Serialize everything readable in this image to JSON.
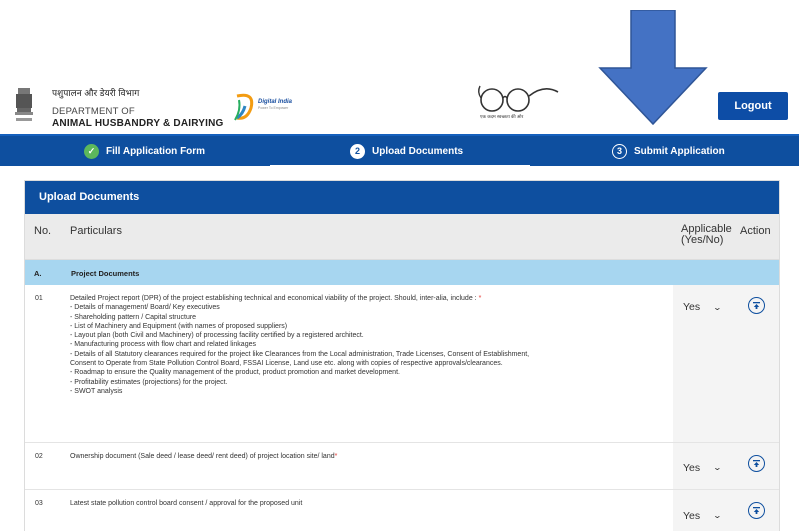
{
  "header": {
    "dept_hindi": "पशुपालन और डेयरी विभाग",
    "dept_line1": "DEPARTMENT OF",
    "dept_line2": "ANIMAL HUSBANDRY & DAIRYING",
    "digital_india_text": "Digital India",
    "digital_india_sub": "Power To Empower",
    "swachh_text": "एक कदम स्वच्छता की ओर",
    "logout_label": "Logout"
  },
  "steps": [
    {
      "number": "✓",
      "label": "Fill Application Form",
      "state": "done"
    },
    {
      "number": "2",
      "label": "Upload Documents",
      "state": "active"
    },
    {
      "number": "3",
      "label": "Submit Application",
      "state": "pending"
    }
  ],
  "card": {
    "title": "Upload Documents",
    "columns": {
      "no": "No.",
      "particulars": "Particulars",
      "applicable": "Applicable (Yes/No)",
      "action": "Action"
    },
    "section": {
      "no": "A.",
      "title": "Project Documents"
    },
    "rows": [
      {
        "no": "01",
        "lines": [
          "Detailed Project report (DPR) of the project establishing technical and economical viability of the project. Should, inter-alia, include :",
          "- Details of management/ Board/ Key executives",
          "- Shareholding pattern / Capital structure",
          "- List of Machinery and Equipment (with names of proposed suppliers)",
          "- Layout plan (both Civil and Machinery) of processing facility certified by a registered architect.",
          "- Manufacturing process with flow chart and related linkages",
          "- Details of all Statutory clearances required for the project like Clearances from the Local administration, Trade Licenses, Consent of Establishment,",
          "Consent to Operate from State Pollution Control Board, FSSAI License, Land use etc. along with copies of respective approvals/clearances.",
          "- Roadmap to ensure the Quality management of the product, product promotion and market development.",
          "- Profitability estimates (projections) for the project.",
          "- SWOT analysis"
        ],
        "required_mark": "*",
        "applicable": "Yes"
      },
      {
        "no": "02",
        "lines": [
          "Ownership document (Sale deed / lease deed/ rent deed) of project location site/ land"
        ],
        "required_mark": "*",
        "applicable": "Yes"
      },
      {
        "no": "03",
        "lines": [
          "Latest state pollution control board consent / approval for the proposed unit"
        ],
        "required_mark": "",
        "applicable": "Yes"
      }
    ]
  },
  "colors": {
    "primary": "#0e4f9f",
    "section_bg": "#a7d6f0",
    "arrow": "#4472c4",
    "success": "#5cb85c"
  }
}
